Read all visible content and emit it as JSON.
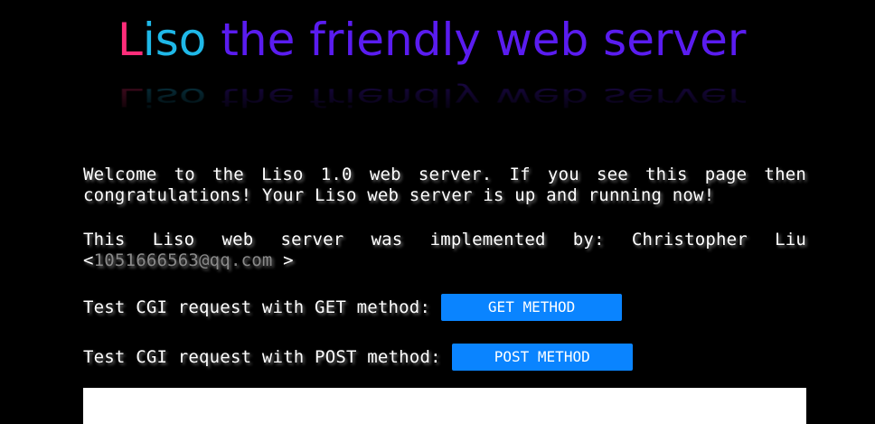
{
  "logo": {
    "letter_l": "L",
    "letters_iso": "iso",
    "rest": " the friendly web server"
  },
  "intro": {
    "text": "Welcome to the Liso 1.0 web server. If you see this page then congratulations! Your Liso web server is up and running now!"
  },
  "author": {
    "text_before": "This Liso web server was implemented by: Christopher Liu <",
    "email": "1051666563@qq.com",
    "text_after": " >"
  },
  "cgi_get": {
    "label": "Test CGI request with GET method:",
    "button_label": "GET METHOD"
  },
  "cgi_post": {
    "label": "Test CGI request with POST method:",
    "button_label": "POST METHOD"
  },
  "colors": {
    "background": "#000000",
    "logo_l": "#ff2d7a",
    "logo_iso": "#1fb8e8",
    "logo_rest": "#5a1cf0",
    "button": "#0a84ff"
  }
}
